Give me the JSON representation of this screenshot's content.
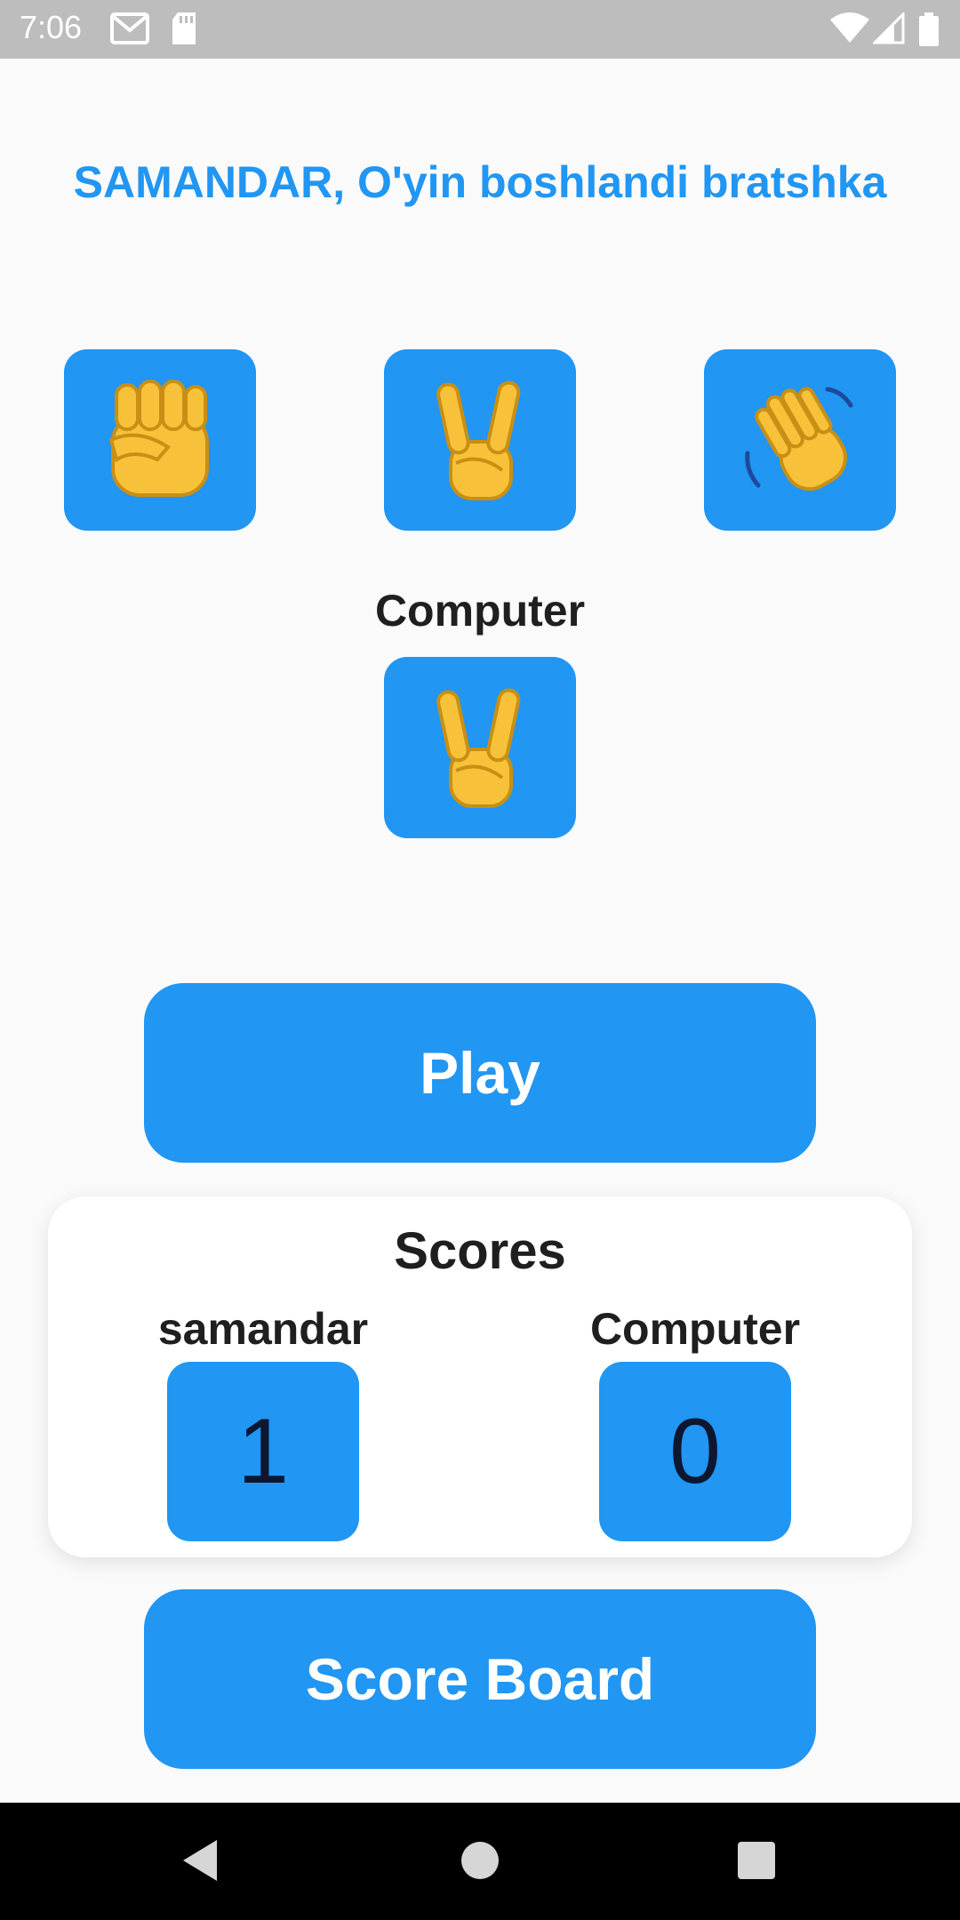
{
  "status_bar": {
    "time": "7:06",
    "left_icons": [
      "gmail-icon",
      "sd-card-icon"
    ],
    "right_icons": [
      "wifi-icon",
      "signal-icon",
      "battery-icon"
    ]
  },
  "game": {
    "title": "SAMANDAR, O'yin boshlandi bratshka",
    "choices": [
      {
        "name": "rock",
        "emoji": "✊"
      },
      {
        "name": "scissors",
        "emoji": "✌️"
      },
      {
        "name": "paper",
        "emoji": "👋"
      }
    ],
    "computer_label": "Computer",
    "computer_choice": {
      "name": "scissors",
      "emoji": "✌️"
    },
    "play_label": "Play"
  },
  "scores": {
    "title": "Scores",
    "player_name": "samandar",
    "player_score": "1",
    "computer_name": "Computer",
    "computer_score": "0"
  },
  "score_board_label": "Score Board",
  "nav": {
    "icons": [
      "back-icon",
      "home-icon",
      "recents-icon"
    ]
  },
  "colors": {
    "accent": "#2196f3",
    "background": "#fafafa",
    "status_bar": "#bdbdbd",
    "nav_bar": "#000000"
  }
}
